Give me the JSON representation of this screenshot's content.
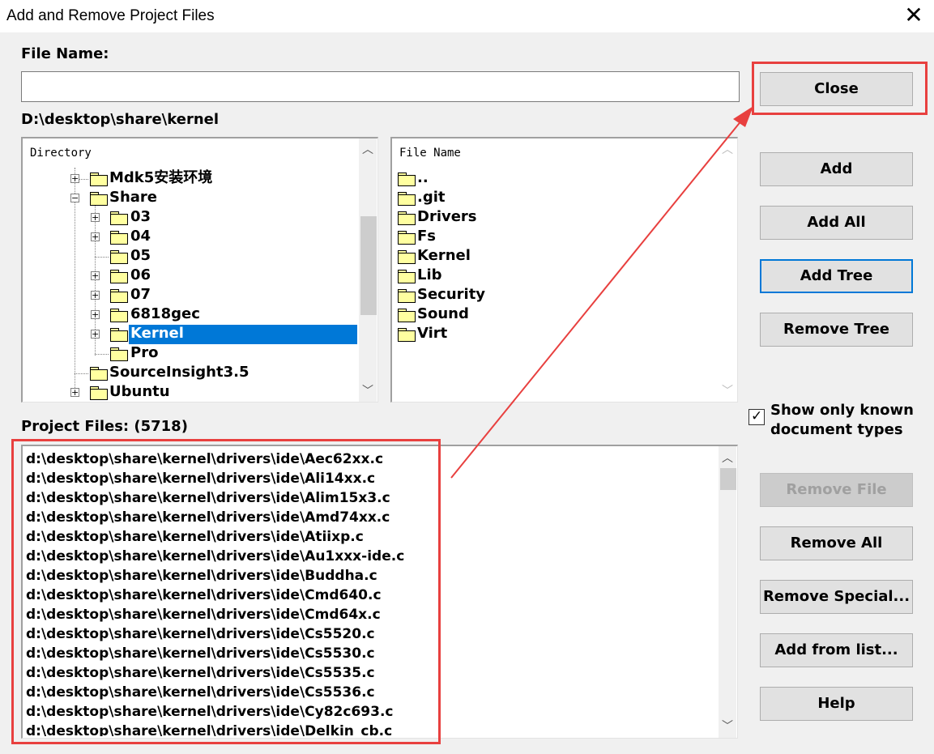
{
  "window": {
    "title": "Add and Remove Project Files",
    "close_glyph": "✕"
  },
  "file_name": {
    "label": "File Name:",
    "value": ""
  },
  "current_path": "D:\\desktop\\share\\kernel",
  "directory": {
    "header": "Directory",
    "items": [
      {
        "label": "Mdk5安装环境",
        "expander": "+"
      },
      {
        "label": "Share",
        "expander": "−"
      },
      {
        "label": "03",
        "expander": "+"
      },
      {
        "label": "04",
        "expander": "+"
      },
      {
        "label": "05",
        "expander": ""
      },
      {
        "label": "06",
        "expander": "+"
      },
      {
        "label": "07",
        "expander": "+"
      },
      {
        "label": "6818gec",
        "expander": "+"
      },
      {
        "label": "Kernel",
        "expander": "+"
      },
      {
        "label": "Pro",
        "expander": ""
      },
      {
        "label": "SourceInsight3.5",
        "expander": ""
      },
      {
        "label": "Ubuntu",
        "expander": "+"
      }
    ]
  },
  "files": {
    "header": "File Name",
    "items": [
      "..",
      ".git",
      "Drivers",
      "Fs",
      "Kernel",
      "Lib",
      "Security",
      "Sound",
      "Virt"
    ]
  },
  "project_files": {
    "label": "Project Files: (5718)",
    "items": [
      "d:\\desktop\\share\\kernel\\drivers\\ide\\Aec62xx.c",
      "d:\\desktop\\share\\kernel\\drivers\\ide\\Ali14xx.c",
      "d:\\desktop\\share\\kernel\\drivers\\ide\\Alim15x3.c",
      "d:\\desktop\\share\\kernel\\drivers\\ide\\Amd74xx.c",
      "d:\\desktop\\share\\kernel\\drivers\\ide\\Atiixp.c",
      "d:\\desktop\\share\\kernel\\drivers\\ide\\Au1xxx-ide.c",
      "d:\\desktop\\share\\kernel\\drivers\\ide\\Buddha.c",
      "d:\\desktop\\share\\kernel\\drivers\\ide\\Cmd640.c",
      "d:\\desktop\\share\\kernel\\drivers\\ide\\Cmd64x.c",
      "d:\\desktop\\share\\kernel\\drivers\\ide\\Cs5520.c",
      "d:\\desktop\\share\\kernel\\drivers\\ide\\Cs5530.c",
      "d:\\desktop\\share\\kernel\\drivers\\ide\\Cs5535.c",
      "d:\\desktop\\share\\kernel\\drivers\\ide\\Cs5536.c",
      "d:\\desktop\\share\\kernel\\drivers\\ide\\Cy82c693.c",
      "d:\\desktop\\share\\kernel\\drivers\\ide\\Delkin_cb.c"
    ]
  },
  "buttons": {
    "close": "Close",
    "add": "Add",
    "add_all": "Add All",
    "add_tree": "Add Tree",
    "remove_tree": "Remove Tree",
    "remove_file": "Remove File",
    "remove_all": "Remove All",
    "remove_special": "Remove Special...",
    "add_from_list": "Add from list...",
    "help": "Help"
  },
  "checkbox": {
    "line1": "Show only known",
    "line2": "document types",
    "checked": true,
    "glyph": "✓"
  },
  "colors": {
    "selection": "#0078d7",
    "annotation": "#e8403f",
    "folder": "#ffffa0"
  }
}
